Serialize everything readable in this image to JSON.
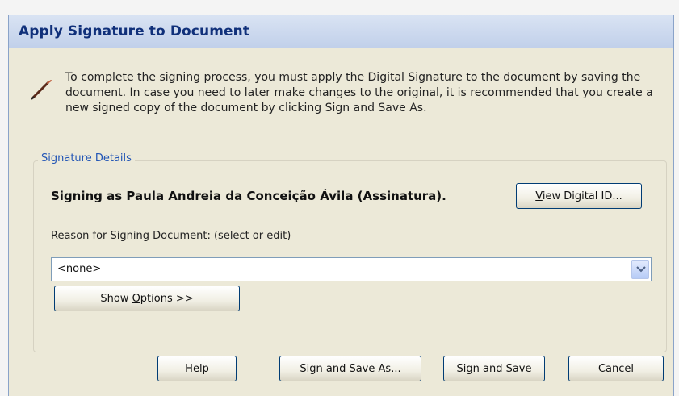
{
  "dialog": {
    "title": "Apply Signature to Document",
    "intro_text": "To complete the signing process, you must apply the Digital Signature to the document by saving the document. In case you need to later make changes to the original, it is recommended that you create a new signed copy of the document by clicking Sign and Save As.",
    "pen_icon": "pen-icon"
  },
  "signature_details": {
    "legend": "Signature Details",
    "signing_as": "Signing as Paula Andreia da Conceição Ávila (Assinatura).",
    "view_id_button": {
      "pre": "",
      "ul": "V",
      "post": "iew Digital ID..."
    },
    "reason_label": {
      "pre": "",
      "ul": "R",
      "post": "eason for Signing Document: (select or edit)"
    },
    "reason_value": "<none>",
    "show_options_button": {
      "pre": "Show ",
      "ul": "O",
      "post": "ptions >>"
    }
  },
  "buttons": {
    "help": {
      "pre": "",
      "ul": "H",
      "post": "elp"
    },
    "sign_save_as": {
      "pre": "Sign and Save ",
      "ul": "A",
      "post": "s..."
    },
    "sign_save": {
      "pre": "",
      "ul": "S",
      "post": "ign and Save"
    },
    "cancel": {
      "pre": "",
      "ul": "C",
      "post": "ancel"
    }
  },
  "colors": {
    "title_text": "#10307a",
    "legend_text": "#2255b5",
    "dialog_bg": "#ece9d8",
    "button_border": "#003c74"
  }
}
